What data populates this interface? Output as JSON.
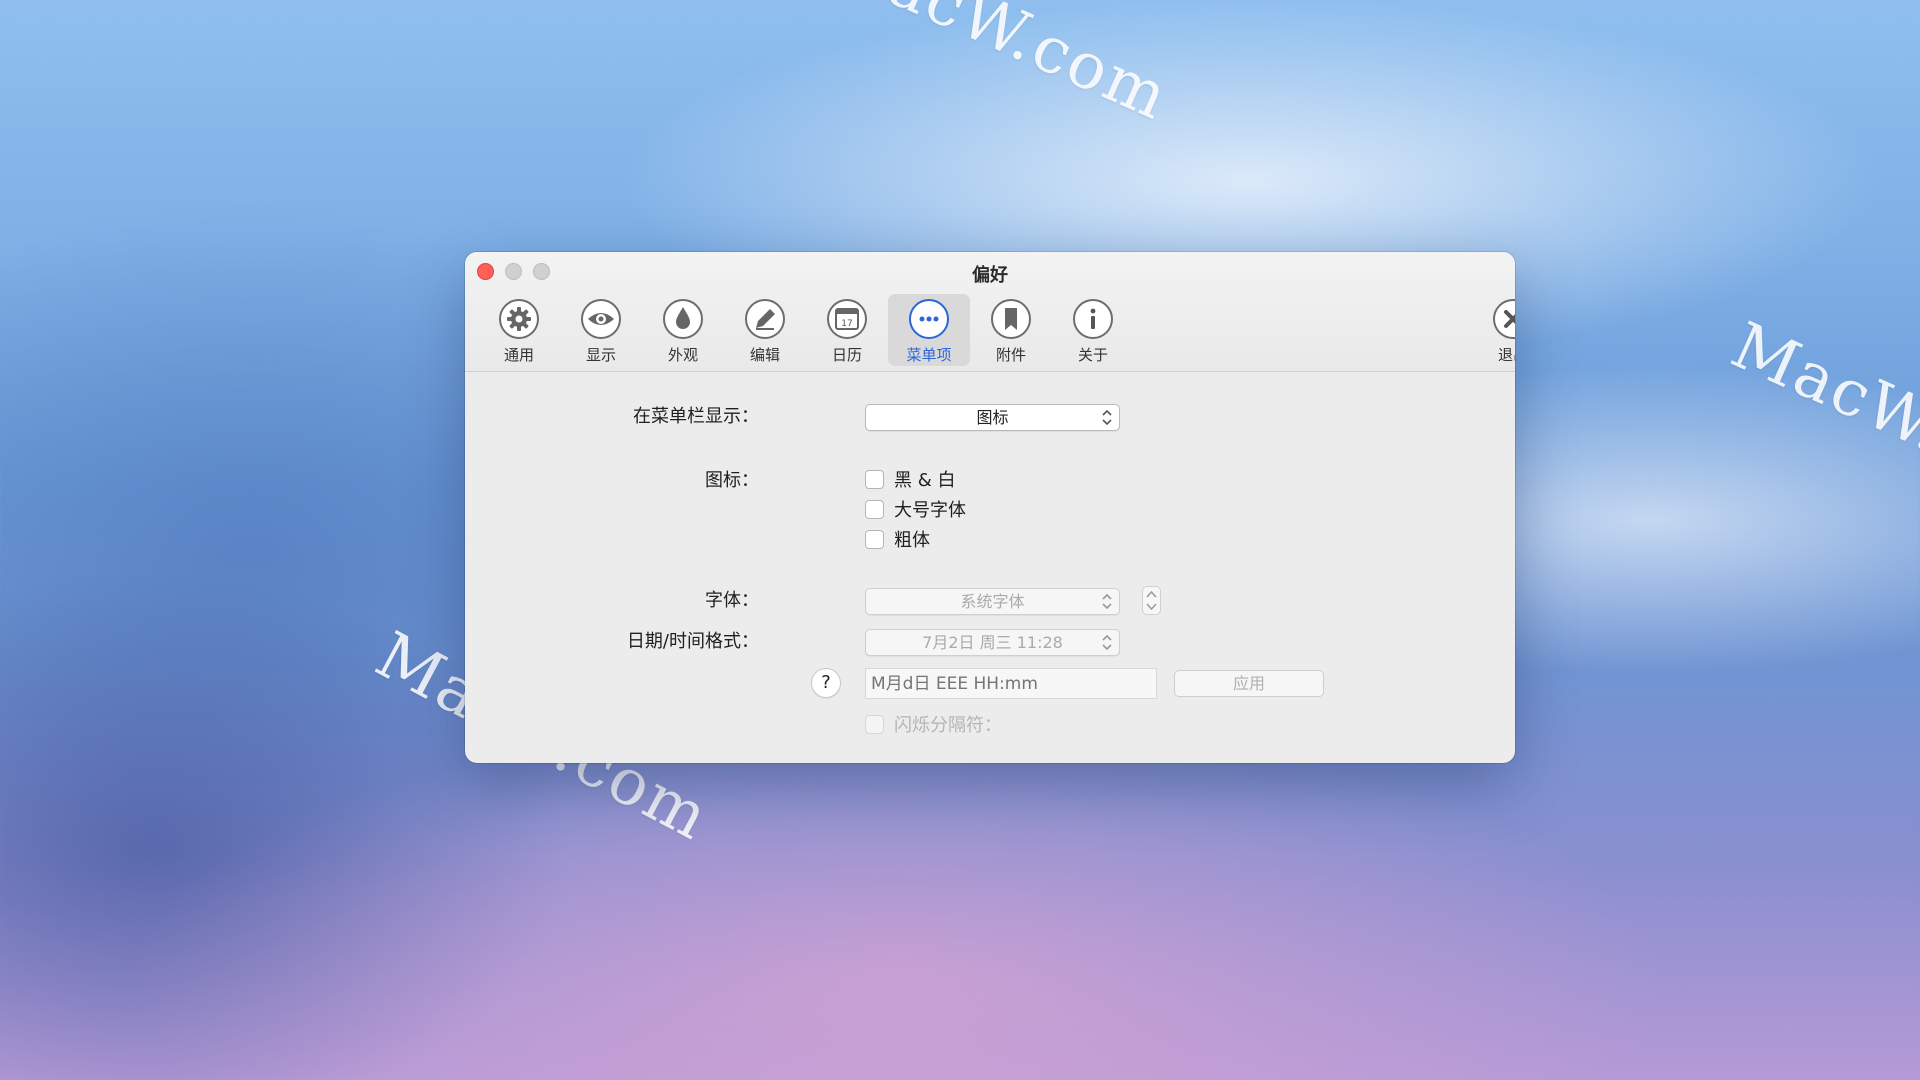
{
  "watermark": "MacW.com",
  "window": {
    "title": "偏好"
  },
  "toolbar": {
    "items": [
      {
        "label": "通用",
        "icon": "gear-icon"
      },
      {
        "label": "显示",
        "icon": "eye-icon"
      },
      {
        "label": "外观",
        "icon": "drop-icon"
      },
      {
        "label": "编辑",
        "icon": "pencil-icon"
      },
      {
        "label": "日历",
        "icon": "calendar-icon",
        "calendar_day": "17"
      },
      {
        "label": "菜单项",
        "icon": "ellipsis-icon",
        "active": true
      },
      {
        "label": "附件",
        "icon": "bookmark-icon"
      },
      {
        "label": "关于",
        "icon": "info-icon"
      }
    ],
    "quit_label": "退出"
  },
  "form": {
    "menubar_show_label": "在菜单栏显示：",
    "menubar_show_value": "图标",
    "icon_label": "图标：",
    "icon_options": [
      "黑 & 白",
      "大号字体",
      "粗体"
    ],
    "font_label": "字体：",
    "font_value": "系统字体",
    "datetime_label": "日期/时间格式：",
    "datetime_value": "7月2日 周三 11:28",
    "help_symbol": "?",
    "format_placeholder": "M月d日 EEE HH:mm",
    "apply_label": "应用",
    "blink_label": "闪烁分隔符："
  },
  "colors": {
    "accent": "#2a66d9",
    "close": "#fe5f57"
  }
}
